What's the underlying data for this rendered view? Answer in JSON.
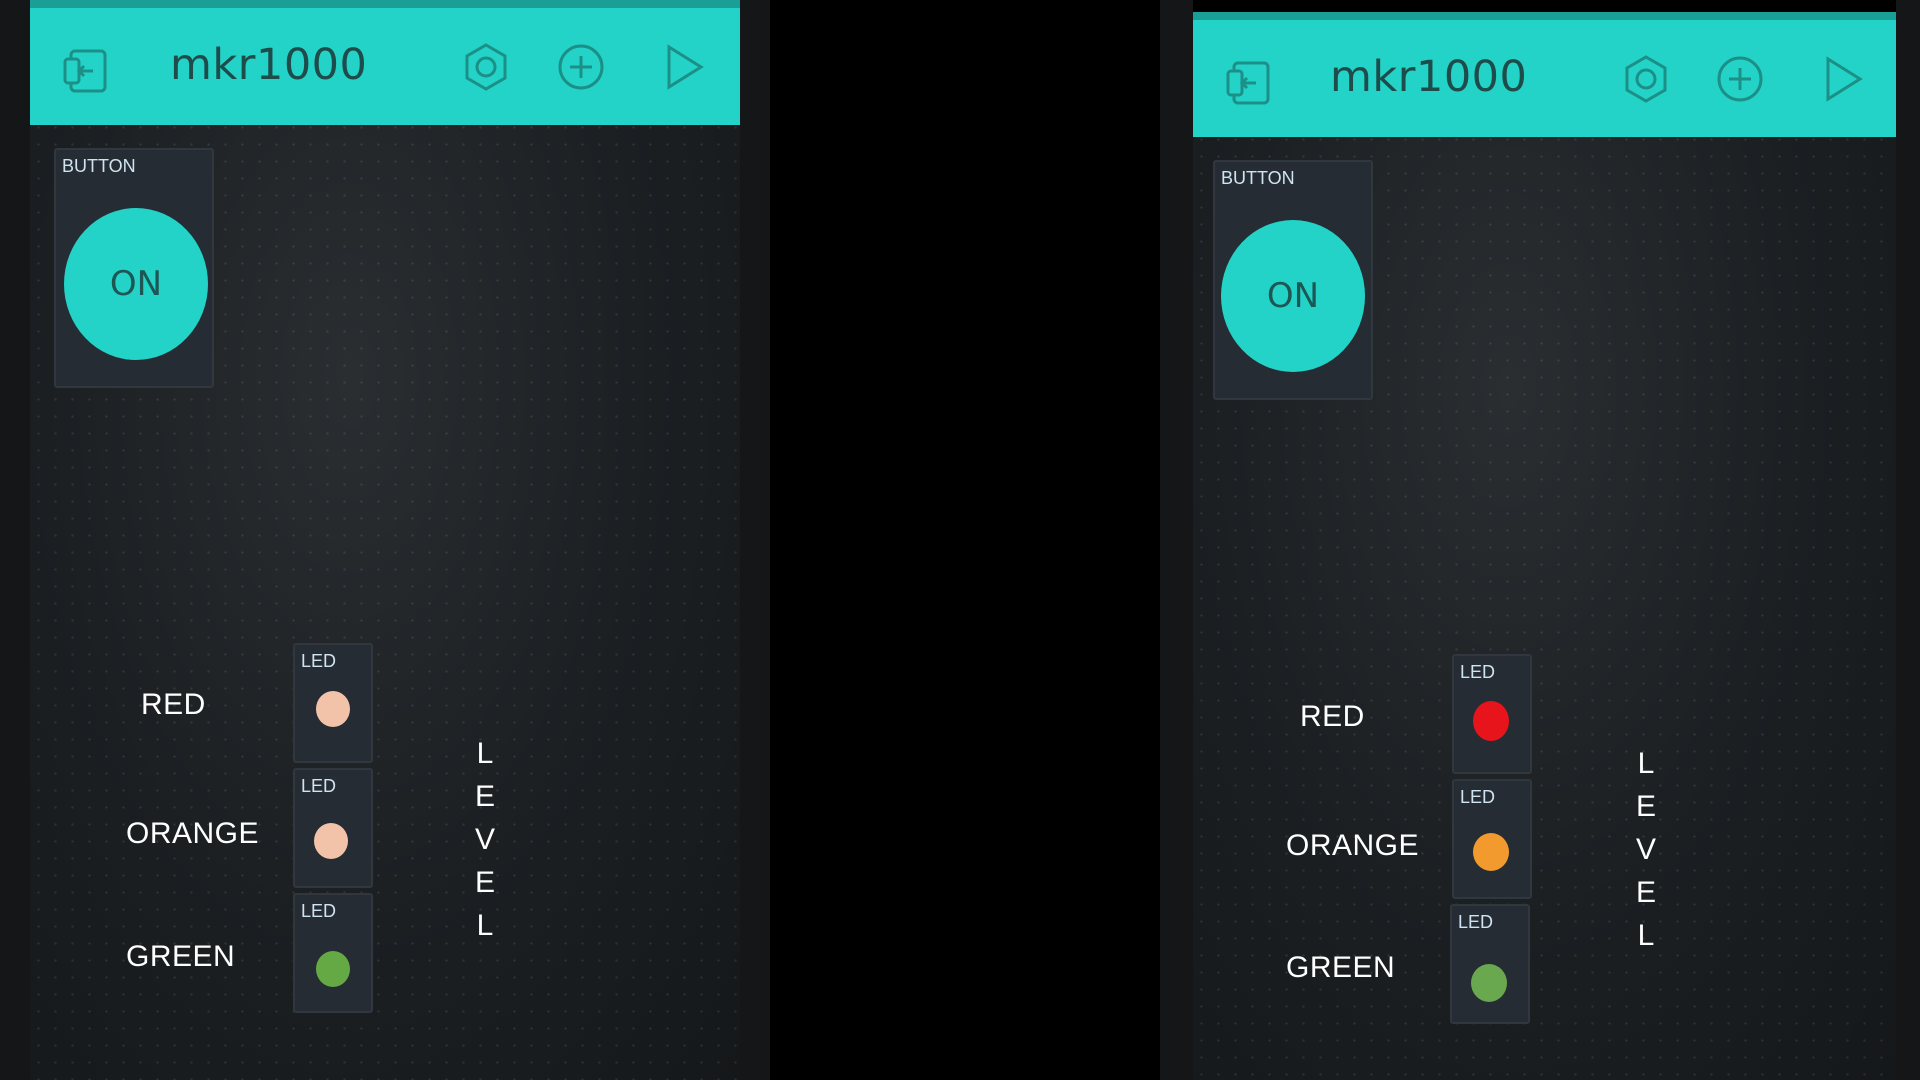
{
  "panels": [
    {
      "project_title": "mkr1000",
      "button_widget": {
        "title": "BUTTON",
        "state_label": "ON"
      },
      "leds": [
        {
          "title": "LED",
          "label": "RED",
          "color": "#f2c3a9"
        },
        {
          "title": "LED",
          "label": "ORANGE",
          "color": "#f2c3a9"
        },
        {
          "title": "LED",
          "label": "GREEN",
          "color": "#64a943"
        }
      ],
      "level_letters": [
        "L",
        "E",
        "V",
        "E",
        "L"
      ]
    },
    {
      "project_title": "mkr1000",
      "button_widget": {
        "title": "BUTTON",
        "state_label": "ON"
      },
      "leds": [
        {
          "title": "LED",
          "label": "RED",
          "color": "#e8141c"
        },
        {
          "title": "LED",
          "label": "ORANGE",
          "color": "#f39a2e"
        },
        {
          "title": "LED",
          "label": "GREEN",
          "color": "#6aa84f"
        }
      ],
      "level_letters": [
        "L",
        "E",
        "V",
        "E",
        "L"
      ]
    }
  ],
  "theme": {
    "accent": "#23d3c8",
    "widget_bg": "#262c33"
  },
  "toolbar_icons": [
    "back-icon",
    "settings-hexagon-icon",
    "add-icon",
    "play-icon"
  ]
}
